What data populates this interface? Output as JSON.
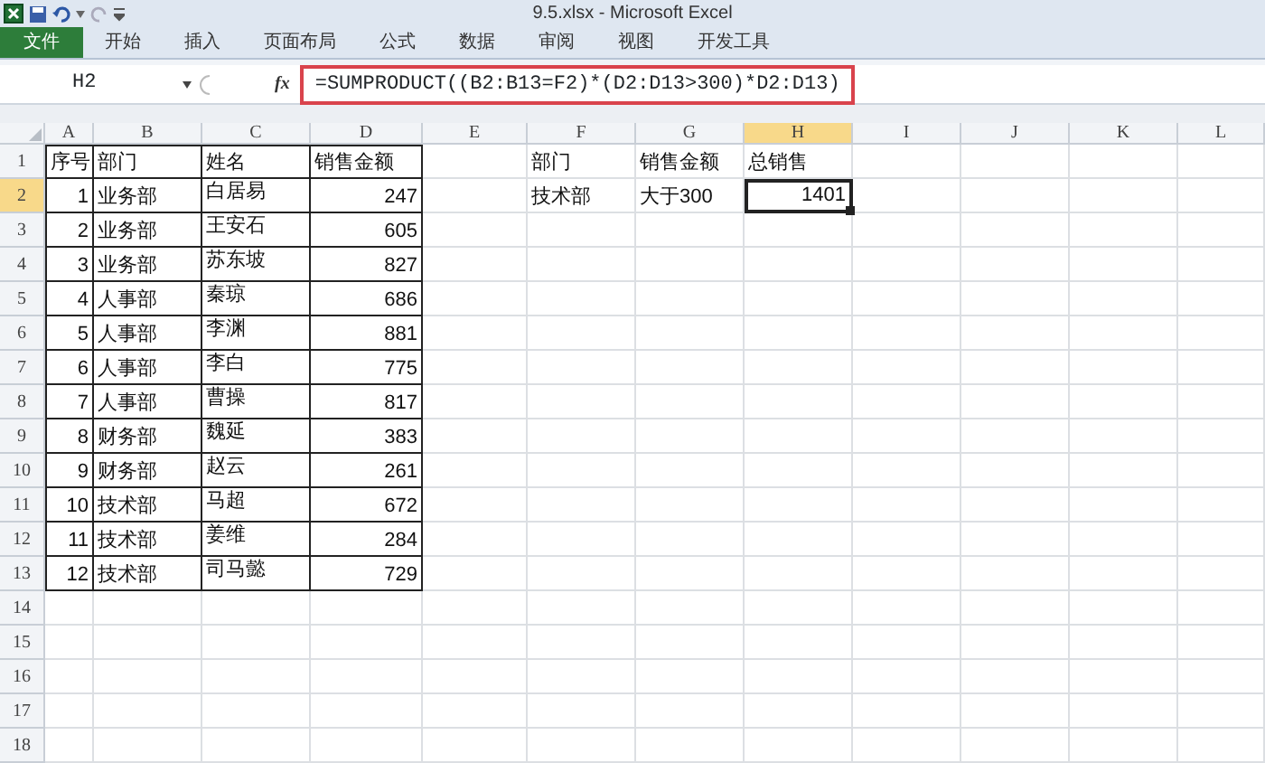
{
  "window": {
    "title": "9.5.xlsx - Microsoft Excel"
  },
  "ribbon_tabs": [
    {
      "label": "文件",
      "kind": "file",
      "selected": false
    },
    {
      "label": "开始",
      "kind": "tab",
      "selected": false
    },
    {
      "label": "插入",
      "kind": "tab",
      "selected": false
    },
    {
      "label": "页面布局",
      "kind": "tab",
      "selected": false
    },
    {
      "label": "公式",
      "kind": "tab",
      "selected": false
    },
    {
      "label": "数据",
      "kind": "tab",
      "selected": false
    },
    {
      "label": "审阅",
      "kind": "tab",
      "selected": false
    },
    {
      "label": "视图",
      "kind": "tab",
      "selected": false
    },
    {
      "label": "开发工具",
      "kind": "tab",
      "selected": false
    }
  ],
  "formula_bar": {
    "name_box": "H2",
    "fx": "fx",
    "formula": "=SUMPRODUCT((B2:B13=F2)*(D2:D13>300)*D2:D13)",
    "highlighted": true
  },
  "columns": [
    {
      "label": "A",
      "selected": false
    },
    {
      "label": "B",
      "selected": false
    },
    {
      "label": "C",
      "selected": false
    },
    {
      "label": "D",
      "selected": false
    },
    {
      "label": "E",
      "selected": false
    },
    {
      "label": "F",
      "selected": false
    },
    {
      "label": "G",
      "selected": false
    },
    {
      "label": "H",
      "selected": true
    },
    {
      "label": "I",
      "selected": false
    },
    {
      "label": "J",
      "selected": false
    },
    {
      "label": "K",
      "selected": false
    },
    {
      "label": "L",
      "selected": false
    }
  ],
  "rows": [
    {
      "label": "1",
      "selected": false
    },
    {
      "label": "2",
      "selected": true
    },
    {
      "label": "3",
      "selected": false
    },
    {
      "label": "4",
      "selected": false
    },
    {
      "label": "5",
      "selected": false
    },
    {
      "label": "6",
      "selected": false
    },
    {
      "label": "7",
      "selected": false
    },
    {
      "label": "8",
      "selected": false
    },
    {
      "label": "9",
      "selected": false
    },
    {
      "label": "10",
      "selected": false
    },
    {
      "label": "11",
      "selected": false
    },
    {
      "label": "12",
      "selected": false
    },
    {
      "label": "13",
      "selected": false
    },
    {
      "label": "14",
      "selected": false
    },
    {
      "label": "15",
      "selected": false
    },
    {
      "label": "16",
      "selected": false
    },
    {
      "label": "17",
      "selected": false
    },
    {
      "label": "18",
      "selected": false
    }
  ],
  "sales_table": [
    [
      "序号",
      "部门",
      "姓名",
      "销售金额"
    ],
    [
      "1",
      "业务部",
      "白居易",
      "247"
    ],
    [
      "2",
      "业务部",
      "王安石",
      "605"
    ],
    [
      "3",
      "业务部",
      "苏东坡",
      "827"
    ],
    [
      "4",
      "人事部",
      "秦琼",
      "686"
    ],
    [
      "5",
      "人事部",
      "李渊",
      "881"
    ],
    [
      "6",
      "人事部",
      "李白",
      "775"
    ],
    [
      "7",
      "人事部",
      "曹操",
      "817"
    ],
    [
      "8",
      "财务部",
      "魏延",
      "383"
    ],
    [
      "9",
      "财务部",
      "赵云",
      "261"
    ],
    [
      "10",
      "技术部",
      "马超",
      "672"
    ],
    [
      "11",
      "技术部",
      "姜维",
      "284"
    ],
    [
      "12",
      "技术部",
      "司马懿",
      "729"
    ]
  ],
  "criteria_table": [
    [
      {
        "text": "部门",
        "selected": false
      },
      {
        "text": "销售金额",
        "selected": false
      },
      {
        "text": "总销售",
        "selected": false
      }
    ],
    [
      {
        "text": "技术部",
        "selected": false
      },
      {
        "text": "大于300",
        "selected": false
      },
      {
        "text": "1401",
        "selected": true
      }
    ]
  ]
}
